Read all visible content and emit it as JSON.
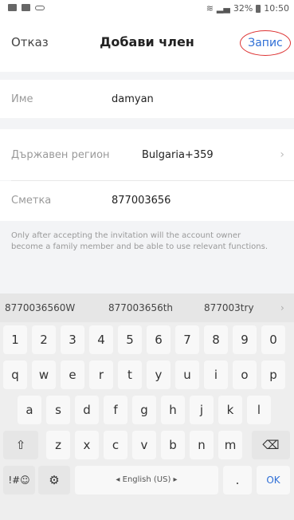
{
  "status_bar": {
    "battery": "32%",
    "time": "10:50"
  },
  "header": {
    "cancel_label": "Отказ",
    "title": "Добави член",
    "save_label": "Запис"
  },
  "form": {
    "name_label": "Име",
    "name_value": "damyan",
    "region_label": "Държавен регион",
    "region_value": "Bulgaria+359",
    "account_label": "Сметка",
    "account_value": "877003656"
  },
  "note": "Only after accepting the invitation will the account owner become a family member and be able to use relevant functions.",
  "keyboard": {
    "suggestions": [
      "87700365‎60W",
      "877003656th",
      "877003try"
    ],
    "row_numbers": [
      "1",
      "2",
      "3",
      "4",
      "5",
      "6",
      "7",
      "8",
      "9",
      "0"
    ],
    "row1": [
      "q",
      "w",
      "e",
      "r",
      "t",
      "y",
      "u",
      "i",
      "o",
      "p"
    ],
    "row2": [
      "a",
      "s",
      "d",
      "f",
      "g",
      "h",
      "j",
      "k",
      "l"
    ],
    "row3": [
      "z",
      "x",
      "c",
      "v",
      "b",
      "n",
      "m"
    ],
    "symbols_label": "!#☺",
    "space_label": "◂ English (US) ▸",
    "ok_label": "OK",
    "period_label": "."
  },
  "colors": {
    "accent": "#2f6fd6",
    "annotation": "#d33333"
  }
}
